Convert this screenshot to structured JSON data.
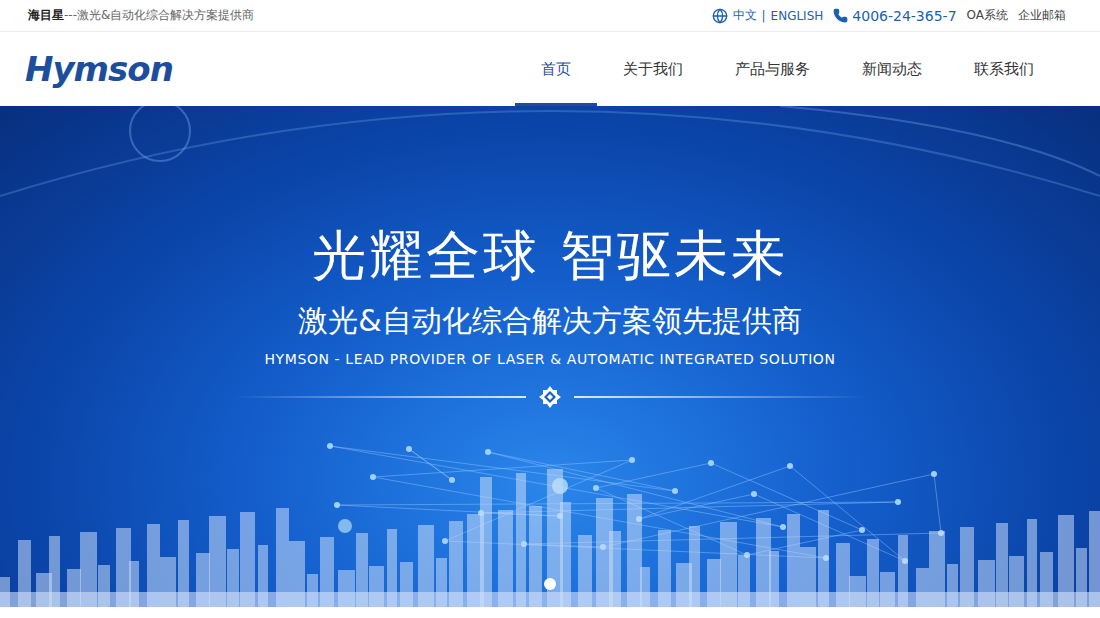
{
  "topbar": {
    "brand": "海目星",
    "tagline": "---激光&自动化综合解决方案提供商",
    "languages": [
      "中文",
      "ENGLISH"
    ],
    "separator": "|",
    "phone": "4006-24-365-7",
    "links": [
      "OA系统",
      "企业邮箱"
    ]
  },
  "header": {
    "logo": "Hymson",
    "nav": [
      {
        "label": "首页",
        "selected": true
      },
      {
        "label": "关于我们",
        "selected": false
      },
      {
        "label": "产品与服务",
        "selected": false
      },
      {
        "label": "新闻动态",
        "selected": false
      },
      {
        "label": "联系我们",
        "selected": false
      }
    ]
  },
  "banner": {
    "title": "光耀全球 智驱未来",
    "subtitle": "激光&自动化综合解决方案领先提供商",
    "english": "HYMSON - LEAD PROVIDER OF LASER & AUTOMATIC INTEGRATED SOLUTION",
    "dots": [
      {
        "selected": true
      }
    ]
  }
}
